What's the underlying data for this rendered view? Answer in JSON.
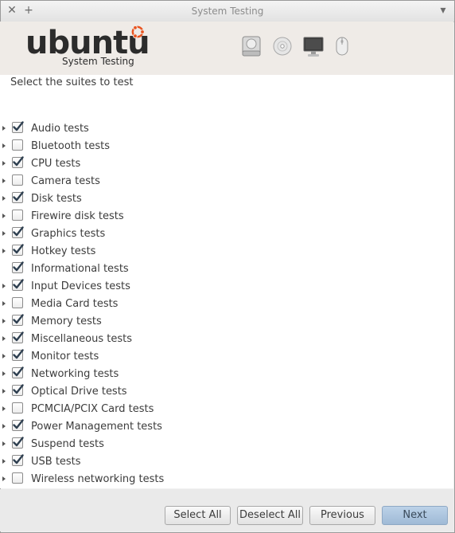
{
  "window": {
    "title": "System Testing",
    "close_glyph": "✕",
    "maximize_glyph": "+",
    "menu_glyph": "▾"
  },
  "banner": {
    "logo_word": "ubuntu",
    "logo_sub": "System Testing",
    "accent": "#e95420",
    "hardware_icons": [
      "hard-disk-icon",
      "optical-disc-icon",
      "monitor-icon",
      "mouse-icon"
    ]
  },
  "prompt": "Select the suites to test",
  "suites": [
    {
      "label": "Audio tests",
      "checked": true,
      "expandable": true
    },
    {
      "label": "Bluetooth tests",
      "checked": false,
      "expandable": true
    },
    {
      "label": "CPU tests",
      "checked": true,
      "expandable": true
    },
    {
      "label": "Camera tests",
      "checked": false,
      "expandable": true
    },
    {
      "label": "Disk tests",
      "checked": true,
      "expandable": true
    },
    {
      "label": "Firewire disk tests",
      "checked": false,
      "expandable": true
    },
    {
      "label": "Graphics tests",
      "checked": true,
      "expandable": true
    },
    {
      "label": "Hotkey tests",
      "checked": true,
      "expandable": true
    },
    {
      "label": "Informational tests",
      "checked": true,
      "expandable": false
    },
    {
      "label": "Input Devices tests",
      "checked": true,
      "expandable": true
    },
    {
      "label": "Media Card tests",
      "checked": false,
      "expandable": true
    },
    {
      "label": "Memory tests",
      "checked": true,
      "expandable": true
    },
    {
      "label": "Miscellaneous tests",
      "checked": true,
      "expandable": true
    },
    {
      "label": "Monitor tests",
      "checked": true,
      "expandable": true
    },
    {
      "label": "Networking tests",
      "checked": true,
      "expandable": true
    },
    {
      "label": "Optical Drive tests",
      "checked": true,
      "expandable": true
    },
    {
      "label": "PCMCIA/PCIX Card tests",
      "checked": false,
      "expandable": true
    },
    {
      "label": "Power Management tests",
      "checked": true,
      "expandable": true
    },
    {
      "label": "Suspend tests",
      "checked": true,
      "expandable": true
    },
    {
      "label": "USB tests",
      "checked": true,
      "expandable": true
    },
    {
      "label": "Wireless networking tests",
      "checked": false,
      "expandable": true
    }
  ],
  "buttons": {
    "select_all": "Select All",
    "deselect_all": "Deselect All",
    "previous": "Previous",
    "next": "Next"
  }
}
